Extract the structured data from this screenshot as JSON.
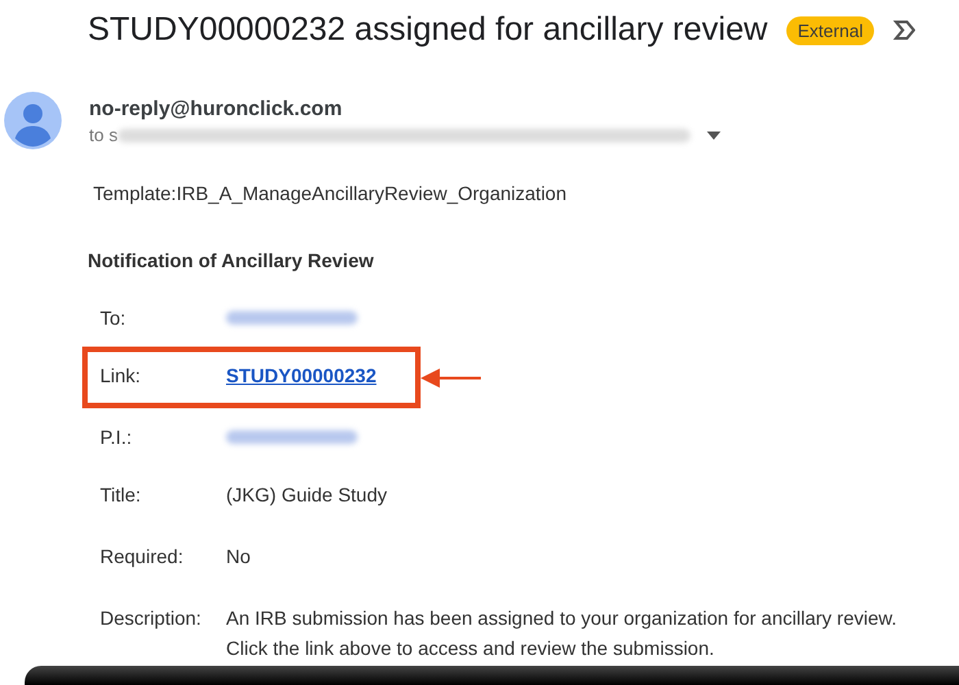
{
  "email": {
    "subject": "STUDY00000232 assigned for ancillary review",
    "label": "External",
    "sender": "no-reply@huronclick.com",
    "recipients_prefix": "to s"
  },
  "body": {
    "template": "Template:IRB_A_ManageAncillaryReview_Organization",
    "heading": "Notification of Ancillary Review",
    "rows": [
      {
        "label": "To:",
        "kind": "redacted",
        "highlighted": false
      },
      {
        "label": "Link:",
        "kind": "link",
        "value": "STUDY00000232",
        "highlighted": true
      },
      {
        "label": "P.I.:",
        "kind": "redacted",
        "highlighted": false
      },
      {
        "label": "Title:",
        "kind": "text",
        "value": "(JKG) Guide Study",
        "highlighted": false
      },
      {
        "label": "Required:",
        "kind": "text",
        "value": "No",
        "highlighted": false
      },
      {
        "label": "Description:",
        "kind": "text",
        "value": "An IRB submission has been assigned to your organization for ancillary review. Click the link above to access and review the submission.",
        "highlighted": false
      }
    ]
  }
}
